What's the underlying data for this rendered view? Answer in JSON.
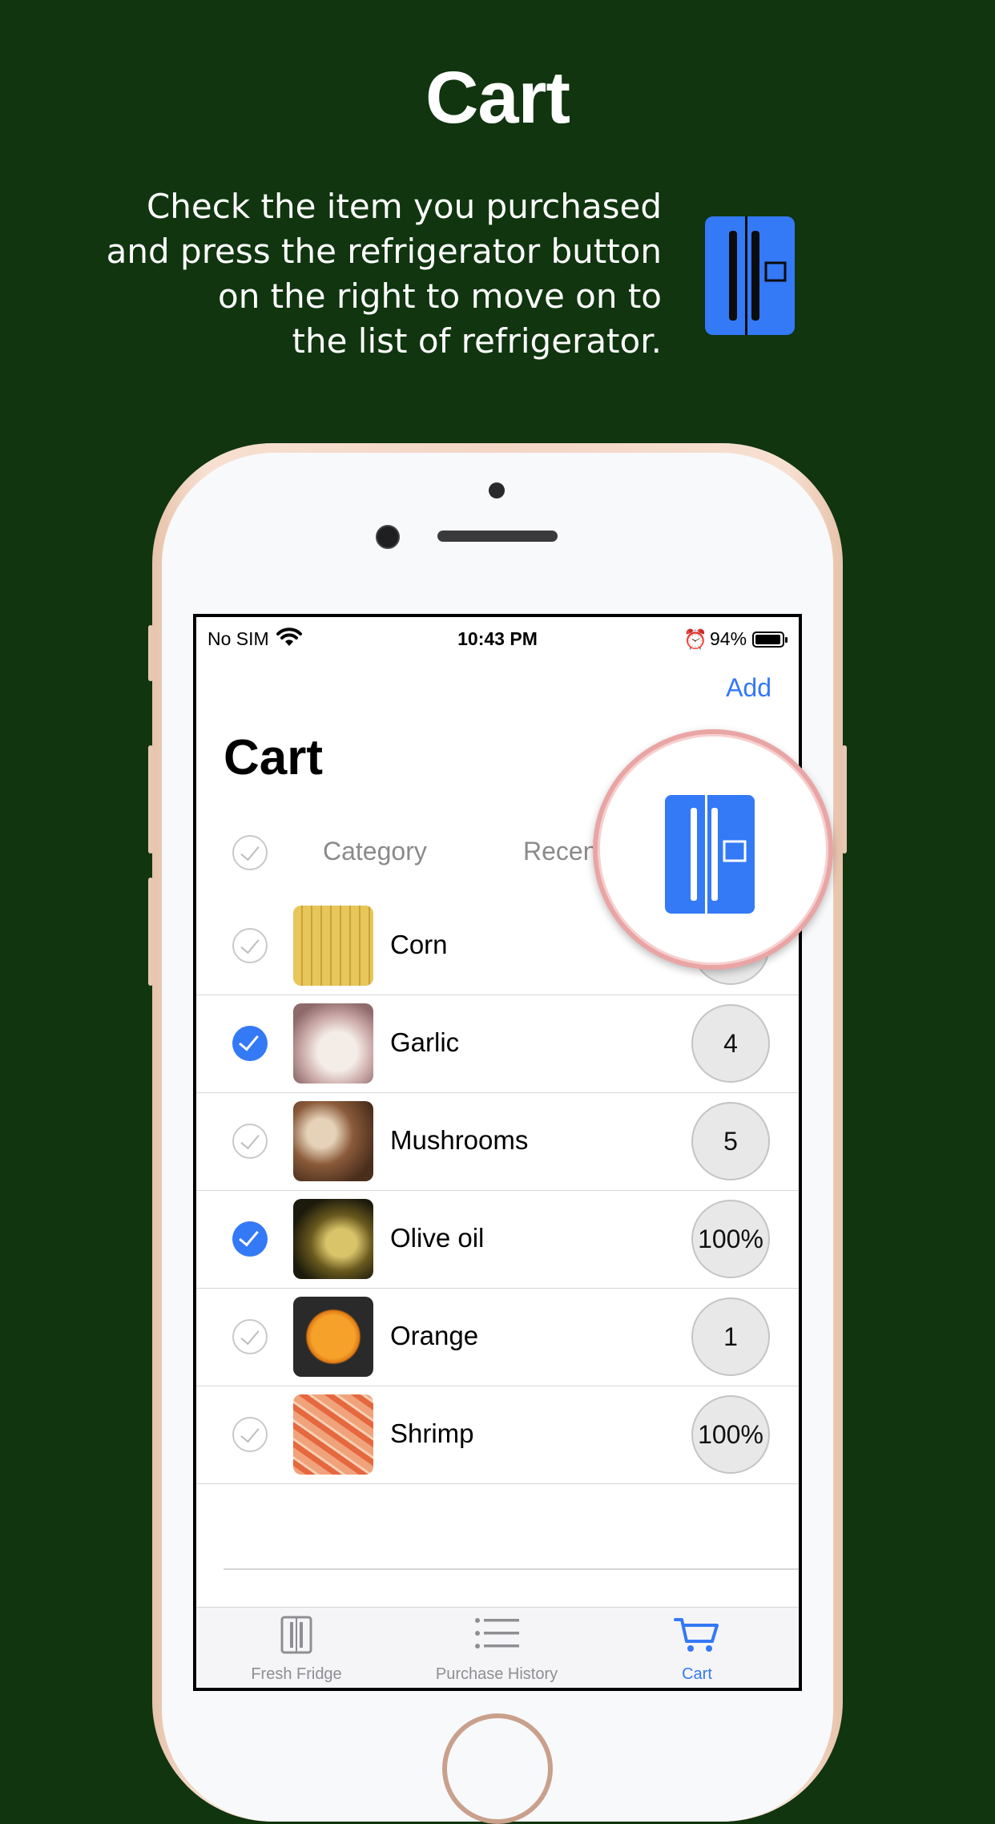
{
  "promo": {
    "headline": "Cart",
    "description_lines": [
      "Check the item you purchased",
      "and press the refrigerator button",
      "on the right to move on to",
      "the list of refrigerator."
    ],
    "icon": "refrigerator-icon",
    "accent_color": "#3479f6",
    "background_color": "#10350f"
  },
  "status_bar": {
    "carrier": "No SIM",
    "time": "10:43 PM",
    "battery": "94%",
    "icons": [
      "wifi-icon",
      "alarm-icon",
      "battery-icon"
    ]
  },
  "nav": {
    "add_label": "Add",
    "title": "Cart"
  },
  "segments": {
    "first": "Category",
    "second": "Recen"
  },
  "items": [
    {
      "name": "Corn",
      "quantity": "",
      "checked": false
    },
    {
      "name": "Garlic",
      "quantity": "4",
      "checked": true
    },
    {
      "name": "Mushrooms",
      "quantity": "5",
      "checked": false
    },
    {
      "name": "Olive oil",
      "quantity": "100%",
      "checked": true
    },
    {
      "name": "Orange",
      "quantity": "1",
      "checked": false
    },
    {
      "name": "Shrimp",
      "quantity": "100%",
      "checked": false
    }
  ],
  "tabbar": {
    "tabs": [
      {
        "label": "Fresh Fridge",
        "icon": "fridge-icon",
        "active": false
      },
      {
        "label": "Purchase History",
        "icon": "list-icon",
        "active": false
      },
      {
        "label": "Cart",
        "icon": "cart-icon",
        "active": true
      }
    ]
  }
}
